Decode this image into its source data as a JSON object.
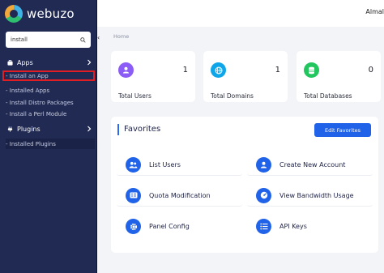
{
  "brand": {
    "name": "webuzo"
  },
  "search": {
    "value": "install"
  },
  "sidebar": {
    "groups": [
      {
        "label": "Apps"
      },
      {
        "label": "Plugins"
      }
    ],
    "apps_items": [
      {
        "label": "- Install an App"
      },
      {
        "label": "- Installed Apps"
      },
      {
        "label": "- Install Distro Packages"
      },
      {
        "label": "- Install a Perl Module"
      }
    ],
    "plugins_items": [
      {
        "label": "- Installed Plugins"
      }
    ]
  },
  "topbar": {
    "user": "Almal"
  },
  "breadcrumb": "Home",
  "stats": [
    {
      "label": "Total Users",
      "value": "1",
      "icon": "user-icon",
      "color": "#8b5cf6"
    },
    {
      "label": "Total Domains",
      "value": "1",
      "icon": "globe-icon",
      "color": "#0ea5e9"
    },
    {
      "label": "Total Databases",
      "value": "0",
      "icon": "database-icon",
      "color": "#22c55e"
    }
  ],
  "favorites": {
    "title": "Favorites",
    "edit_label": "Edit Favorites",
    "items": [
      {
        "label": "List Users",
        "icon": "users-icon"
      },
      {
        "label": "Create New Account",
        "icon": "user-plus-icon"
      },
      {
        "label": "Quota Modification",
        "icon": "list-card-icon"
      },
      {
        "label": "View Bandwidth Usage",
        "icon": "gauge-icon"
      },
      {
        "label": "Panel Config",
        "icon": "gear-icon"
      },
      {
        "label": "API Keys",
        "icon": "key-list-icon"
      }
    ]
  }
}
